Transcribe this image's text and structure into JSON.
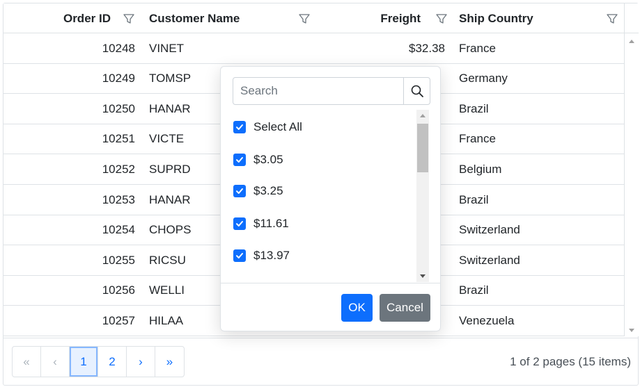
{
  "grid": {
    "columns": [
      {
        "key": "order_id",
        "label": "Order ID"
      },
      {
        "key": "customer_name",
        "label": "Customer Name"
      },
      {
        "key": "freight",
        "label": "Freight"
      },
      {
        "key": "ship_country",
        "label": "Ship Country"
      }
    ],
    "rows": [
      {
        "order_id": "10248",
        "customer": "VINET",
        "freight": "$32.38",
        "country": "France"
      },
      {
        "order_id": "10249",
        "customer": "TOMSP",
        "freight": "",
        "country": "Germany"
      },
      {
        "order_id": "10250",
        "customer": "HANAR",
        "freight": "",
        "country": "Brazil"
      },
      {
        "order_id": "10251",
        "customer": "VICTE",
        "freight": "",
        "country": "France"
      },
      {
        "order_id": "10252",
        "customer": "SUPRD",
        "freight": "",
        "country": "Belgium"
      },
      {
        "order_id": "10253",
        "customer": "HANAR",
        "freight": "",
        "country": "Brazil"
      },
      {
        "order_id": "10254",
        "customer": "CHOPS",
        "freight": "",
        "country": "Switzerland"
      },
      {
        "order_id": "10255",
        "customer": "RICSU",
        "freight": "",
        "country": "Switzerland"
      },
      {
        "order_id": "10256",
        "customer": "WELLI",
        "freight": "",
        "country": "Brazil"
      },
      {
        "order_id": "10257",
        "customer": "HILAA",
        "freight": "",
        "country": "Venezuela"
      }
    ]
  },
  "pager": {
    "first": "«",
    "prev": "‹",
    "pages": [
      "1",
      "2"
    ],
    "current_page": "1",
    "next": "›",
    "last": "»",
    "info": "1 of 2 pages (15 items)"
  },
  "filter_popup": {
    "search_placeholder": "Search",
    "search_value": "",
    "items": [
      {
        "label": "Select All",
        "checked": true
      },
      {
        "label": "$3.05",
        "checked": true
      },
      {
        "label": "$3.25",
        "checked": true
      },
      {
        "label": "$11.61",
        "checked": true
      },
      {
        "label": "$13.97",
        "checked": true
      }
    ],
    "ok_label": "OK",
    "cancel_label": "Cancel"
  },
  "colors": {
    "accent": "#0d6efd",
    "secondary": "#6c757d",
    "border": "#dee2e6"
  },
  "icons": {
    "filter": "funnel-icon",
    "search": "search-icon",
    "check": "check-icon"
  }
}
